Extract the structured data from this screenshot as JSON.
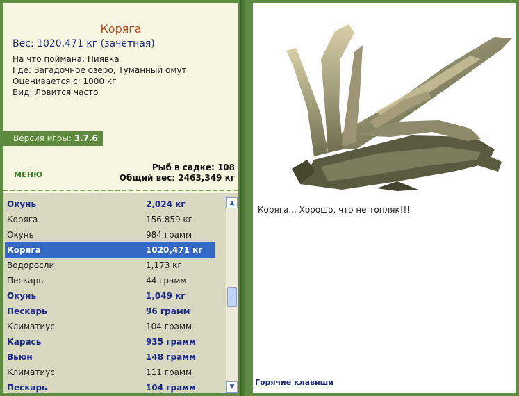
{
  "catch": {
    "name": "Коряга",
    "weight": "Вес: 1020,471 кг (зачетная)",
    "details": [
      "На что поймана: Пиявка",
      "Где: Загадочное озеро, Туманный омут",
      "Оценивается с: 1000 кг",
      "Вид: Ловится часто"
    ]
  },
  "version": {
    "label": "Версия игры: ",
    "number": "3.7.6"
  },
  "menu_label": "МЕНЮ",
  "stats": {
    "fish_in_cage": "Рыб в садке: 108",
    "total_weight": "Общий вес: 2463,349 кг"
  },
  "fish_list": [
    {
      "name": "Окунь",
      "weight": "2,024 кг",
      "style": "bold"
    },
    {
      "name": "Коряга",
      "weight": "156,859 кг",
      "style": "normal"
    },
    {
      "name": "Окунь",
      "weight": "984 грамм",
      "style": "normal"
    },
    {
      "name": "Коряга",
      "weight": "1020,471 кг",
      "style": "selected"
    },
    {
      "name": "Водоросли",
      "weight": "1,173 кг",
      "style": "normal"
    },
    {
      "name": "Пескарь",
      "weight": "44 грамм",
      "style": "normal"
    },
    {
      "name": "Окунь",
      "weight": "1,049 кг",
      "style": "bold"
    },
    {
      "name": "Пескарь",
      "weight": "96 грамм",
      "style": "bold"
    },
    {
      "name": "Климатиус",
      "weight": "104 грамм",
      "style": "normal"
    },
    {
      "name": "Карась",
      "weight": "935 грамм",
      "style": "bold"
    },
    {
      "name": "Вьюн",
      "weight": "148 грамм",
      "style": "bold"
    },
    {
      "name": "Климатиус",
      "weight": "111 грамм",
      "style": "normal"
    },
    {
      "name": "Пескарь",
      "weight": "104 грамм",
      "style": "bold"
    }
  ],
  "caption": "Коряга... Хорошо, что не топляк!!!",
  "hotkeys_label": "Горячие клавиши",
  "icons": {
    "scroll_up": "triangle-up",
    "scroll_down": "triangle-down"
  },
  "colors": {
    "frame": "#5f8b42",
    "selected": "#3468c6",
    "name_accent": "#b3521d",
    "weight_accent": "#1a2a7a"
  }
}
